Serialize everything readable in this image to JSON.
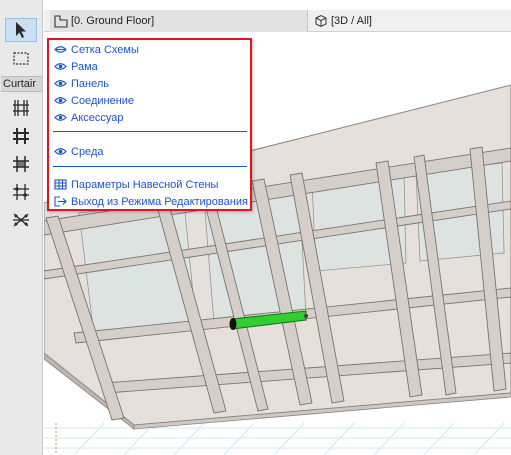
{
  "toolbox": {
    "category_label": "Curtair",
    "tools": [
      "arrow-tool",
      "marquee-tool",
      "grid-tool",
      "frame-tool",
      "panel-tool",
      "junction-tool",
      "accessory-tool"
    ]
  },
  "tabs": {
    "floor_plan": "[0. Ground Floor]",
    "view_3d": "[3D / All]"
  },
  "context_menu": {
    "items": [
      {
        "label": "Сетка Схемы",
        "icon": "eye-closed-icon"
      },
      {
        "label": "Рама",
        "icon": "eye-icon"
      },
      {
        "label": "Панель",
        "icon": "eye-icon"
      },
      {
        "label": "Соединение",
        "icon": "eye-icon"
      },
      {
        "label": "Аксессуар",
        "icon": "eye-icon"
      },
      {
        "label": "Среда",
        "icon": "eye-icon"
      },
      {
        "label": "Параметры Навесной Стены",
        "icon": "settings-grid-icon"
      },
      {
        "label": "Выход из Режима Редактирования",
        "icon": "exit-icon"
      }
    ],
    "border_color": "#e0161e",
    "text_color": "#1a56c8"
  },
  "colors": {
    "toolbox_bg": "#e9e9e9",
    "selected_tool": "#c9dff5",
    "frame_fill": "#d8d0cc",
    "panel_fill": "#dfe4e2",
    "selected_frame": "#33cc33",
    "ground_grid": "#d4eef3"
  }
}
